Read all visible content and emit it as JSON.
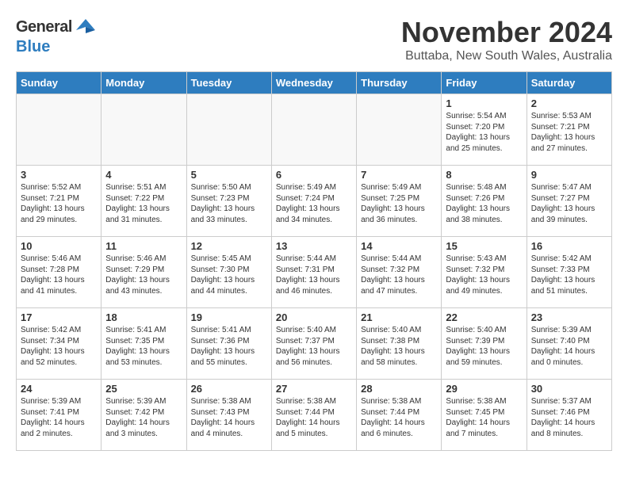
{
  "header": {
    "logo_general": "General",
    "logo_blue": "Blue",
    "month_title": "November 2024",
    "location": "Buttaba, New South Wales, Australia"
  },
  "weekdays": [
    "Sunday",
    "Monday",
    "Tuesday",
    "Wednesday",
    "Thursday",
    "Friday",
    "Saturday"
  ],
  "weeks": [
    [
      {
        "day": "",
        "info": ""
      },
      {
        "day": "",
        "info": ""
      },
      {
        "day": "",
        "info": ""
      },
      {
        "day": "",
        "info": ""
      },
      {
        "day": "",
        "info": ""
      },
      {
        "day": "1",
        "info": "Sunrise: 5:54 AM\nSunset: 7:20 PM\nDaylight: 13 hours and 25 minutes."
      },
      {
        "day": "2",
        "info": "Sunrise: 5:53 AM\nSunset: 7:21 PM\nDaylight: 13 hours and 27 minutes."
      }
    ],
    [
      {
        "day": "3",
        "info": "Sunrise: 5:52 AM\nSunset: 7:21 PM\nDaylight: 13 hours and 29 minutes."
      },
      {
        "day": "4",
        "info": "Sunrise: 5:51 AM\nSunset: 7:22 PM\nDaylight: 13 hours and 31 minutes."
      },
      {
        "day": "5",
        "info": "Sunrise: 5:50 AM\nSunset: 7:23 PM\nDaylight: 13 hours and 33 minutes."
      },
      {
        "day": "6",
        "info": "Sunrise: 5:49 AM\nSunset: 7:24 PM\nDaylight: 13 hours and 34 minutes."
      },
      {
        "day": "7",
        "info": "Sunrise: 5:49 AM\nSunset: 7:25 PM\nDaylight: 13 hours and 36 minutes."
      },
      {
        "day": "8",
        "info": "Sunrise: 5:48 AM\nSunset: 7:26 PM\nDaylight: 13 hours and 38 minutes."
      },
      {
        "day": "9",
        "info": "Sunrise: 5:47 AM\nSunset: 7:27 PM\nDaylight: 13 hours and 39 minutes."
      }
    ],
    [
      {
        "day": "10",
        "info": "Sunrise: 5:46 AM\nSunset: 7:28 PM\nDaylight: 13 hours and 41 minutes."
      },
      {
        "day": "11",
        "info": "Sunrise: 5:46 AM\nSunset: 7:29 PM\nDaylight: 13 hours and 43 minutes."
      },
      {
        "day": "12",
        "info": "Sunrise: 5:45 AM\nSunset: 7:30 PM\nDaylight: 13 hours and 44 minutes."
      },
      {
        "day": "13",
        "info": "Sunrise: 5:44 AM\nSunset: 7:31 PM\nDaylight: 13 hours and 46 minutes."
      },
      {
        "day": "14",
        "info": "Sunrise: 5:44 AM\nSunset: 7:32 PM\nDaylight: 13 hours and 47 minutes."
      },
      {
        "day": "15",
        "info": "Sunrise: 5:43 AM\nSunset: 7:32 PM\nDaylight: 13 hours and 49 minutes."
      },
      {
        "day": "16",
        "info": "Sunrise: 5:42 AM\nSunset: 7:33 PM\nDaylight: 13 hours and 51 minutes."
      }
    ],
    [
      {
        "day": "17",
        "info": "Sunrise: 5:42 AM\nSunset: 7:34 PM\nDaylight: 13 hours and 52 minutes."
      },
      {
        "day": "18",
        "info": "Sunrise: 5:41 AM\nSunset: 7:35 PM\nDaylight: 13 hours and 53 minutes."
      },
      {
        "day": "19",
        "info": "Sunrise: 5:41 AM\nSunset: 7:36 PM\nDaylight: 13 hours and 55 minutes."
      },
      {
        "day": "20",
        "info": "Sunrise: 5:40 AM\nSunset: 7:37 PM\nDaylight: 13 hours and 56 minutes."
      },
      {
        "day": "21",
        "info": "Sunrise: 5:40 AM\nSunset: 7:38 PM\nDaylight: 13 hours and 58 minutes."
      },
      {
        "day": "22",
        "info": "Sunrise: 5:40 AM\nSunset: 7:39 PM\nDaylight: 13 hours and 59 minutes."
      },
      {
        "day": "23",
        "info": "Sunrise: 5:39 AM\nSunset: 7:40 PM\nDaylight: 14 hours and 0 minutes."
      }
    ],
    [
      {
        "day": "24",
        "info": "Sunrise: 5:39 AM\nSunset: 7:41 PM\nDaylight: 14 hours and 2 minutes."
      },
      {
        "day": "25",
        "info": "Sunrise: 5:39 AM\nSunset: 7:42 PM\nDaylight: 14 hours and 3 minutes."
      },
      {
        "day": "26",
        "info": "Sunrise: 5:38 AM\nSunset: 7:43 PM\nDaylight: 14 hours and 4 minutes."
      },
      {
        "day": "27",
        "info": "Sunrise: 5:38 AM\nSunset: 7:44 PM\nDaylight: 14 hours and 5 minutes."
      },
      {
        "day": "28",
        "info": "Sunrise: 5:38 AM\nSunset: 7:44 PM\nDaylight: 14 hours and 6 minutes."
      },
      {
        "day": "29",
        "info": "Sunrise: 5:38 AM\nSunset: 7:45 PM\nDaylight: 14 hours and 7 minutes."
      },
      {
        "day": "30",
        "info": "Sunrise: 5:37 AM\nSunset: 7:46 PM\nDaylight: 14 hours and 8 minutes."
      }
    ]
  ]
}
